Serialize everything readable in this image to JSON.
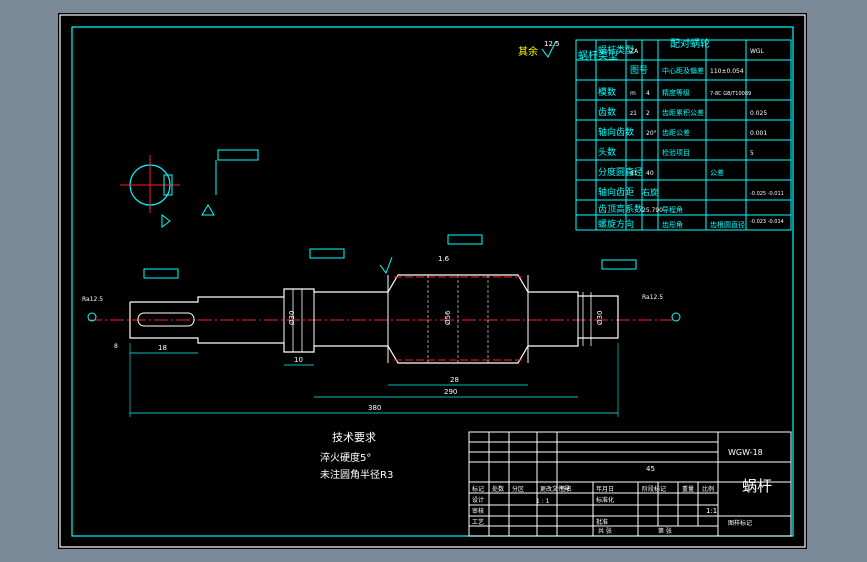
{
  "drawing": {
    "title_block": {
      "drawing_number": "WGW-18",
      "part_name": "蜗杆",
      "scale": "1:1",
      "ratio_row": "1 : 1",
      "center_label": "45",
      "sheet_label": "图样标记",
      "header_cells": [
        "标记",
        "处数",
        "分区",
        "更改文件号",
        "签名",
        "年月日"
      ],
      "role_cells": [
        "设计",
        "标准化",
        "审核",
        "工艺",
        "批准"
      ],
      "meta_cells": [
        "阶段标记",
        "重量",
        "比例",
        "共  张",
        "第  张"
      ]
    },
    "notes": {
      "heading": "技术要求",
      "lines": [
        "淬火硬度5°",
        "未注圆角半径R3"
      ]
    },
    "param_table": {
      "header_left": "蜗杆类型",
      "header_right": "配对蜗轮",
      "cells": [
        [
          "蜗杆类型",
          "ZA",
          "",
          "图号",
          "WGL"
        ],
        [
          "模数",
          "m",
          "4",
          "中心距及偏差",
          "110±0.054"
        ],
        [
          "齿数",
          "z1",
          "2",
          "精度等级",
          "7-8C GB/T10089"
        ],
        [
          "轴向齿数",
          "",
          "20°",
          "齿距累积公差",
          "0.025"
        ],
        [
          "头数",
          "",
          "",
          "齿距公差",
          "0.001"
        ],
        [
          "分度圆直径",
          "d1",
          "40",
          "",
          ""
        ],
        [
          "轴向齿距",
          "",
          "",
          "检验项目",
          "5"
        ],
        [
          "齿顶高系数",
          "",
          "",
          "",
          ""
        ],
        [
          "螺旋方向",
          "",
          "右旋",
          "公差",
          "-0.025 -0.011"
        ],
        [
          "导程角",
          "",
          "",
          "",
          ""
        ],
        [
          "齿形角",
          "",
          "25.790",
          "",
          "-0.023 -0.014"
        ],
        [
          "齿根圆直径",
          "",
          "",
          "",
          ""
        ]
      ]
    },
    "dimensions": {
      "overall": "380",
      "sub_a": "290",
      "sub_b": "28",
      "sub_c": "18",
      "sub_d": "10",
      "keyway": "8",
      "dia_main": "Ø56",
      "dia_left": "Ø30",
      "dia_right": "Ø30"
    },
    "symbols": {
      "roughness_top": "1.6",
      "roughness_left": "Ra12.5",
      "roughness_right": "Ra12.5",
      "remark_label": "其余",
      "remark_value": "12.5"
    }
  }
}
